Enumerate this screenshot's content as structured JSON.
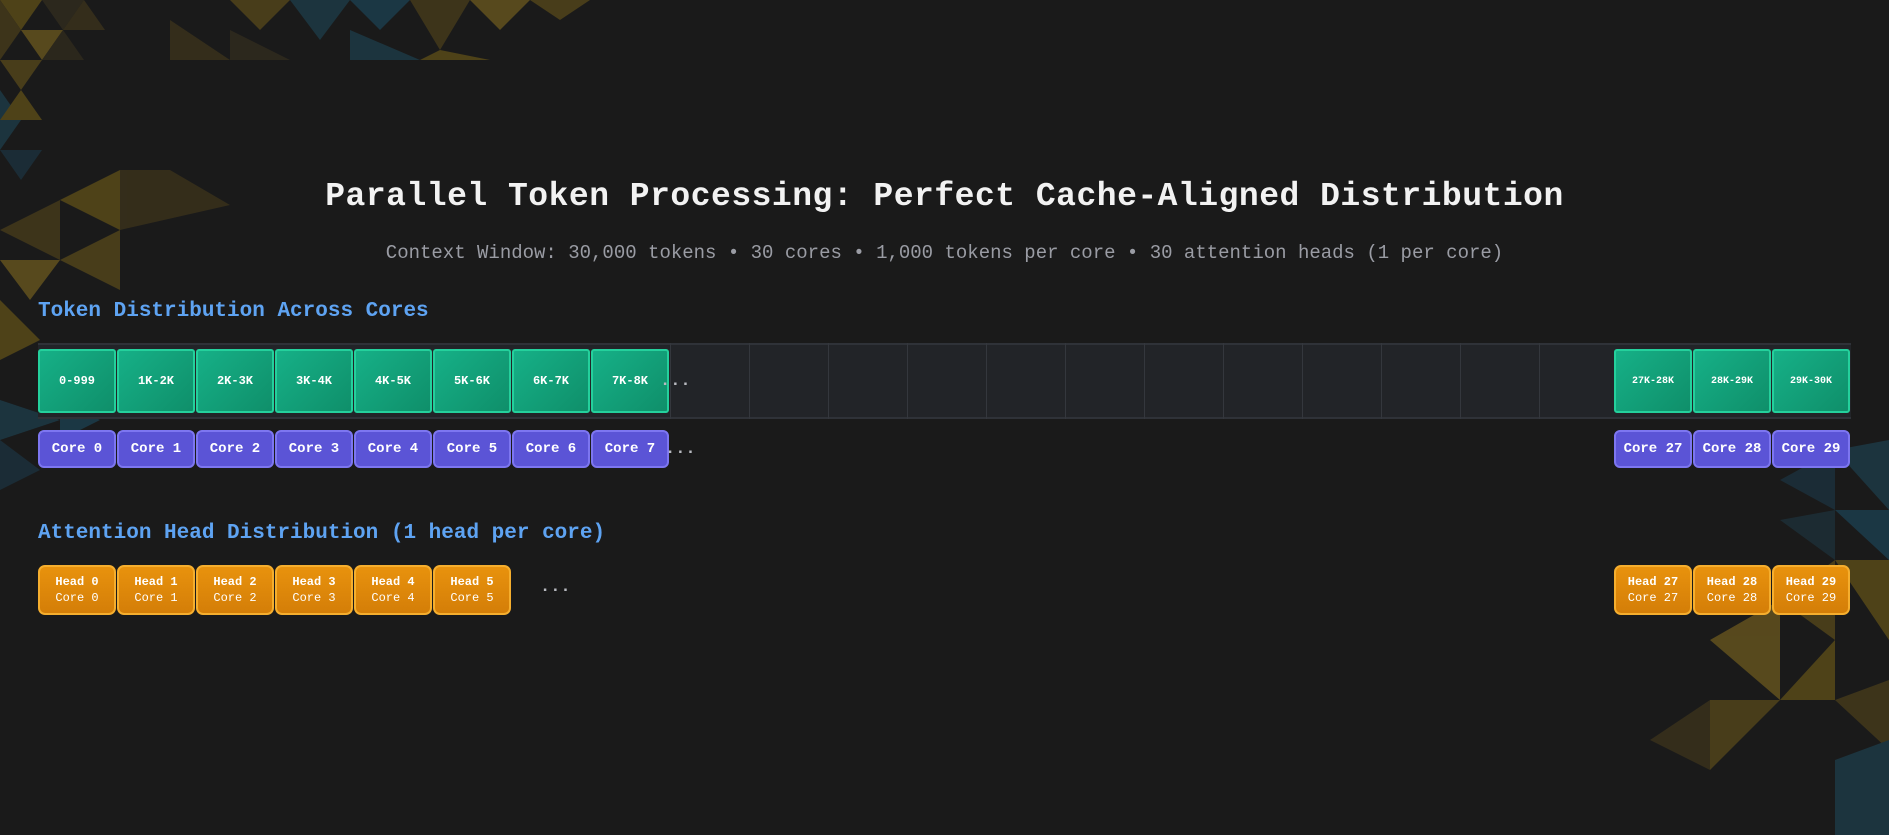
{
  "title": "Parallel Token Processing: Perfect Cache-Aligned Distribution",
  "subtitle": "Context Window: 30,000 tokens • 30 cores • 1,000 tokens per core • 30 attention heads (1 per core)",
  "sections": {
    "tokens": "Token Distribution Across Cores",
    "heads": "Attention Head Distribution (1 head per core)"
  },
  "tokens_left": [
    "0-999",
    "1K-2K",
    "2K-3K",
    "3K-4K",
    "4K-5K",
    "5K-6K",
    "6K-7K",
    "7K-8K"
  ],
  "tokens_right": [
    "27K-28K",
    "28K-29K",
    "29K-30K"
  ],
  "cores_left": [
    "Core 0",
    "Core 1",
    "Core 2",
    "Core 3",
    "Core 4",
    "Core 5",
    "Core 6",
    "Core 7"
  ],
  "cores_right": [
    "Core 27",
    "Core 28",
    "Core 29"
  ],
  "heads_left": [
    {
      "head": "Head 0",
      "core": "Core 0"
    },
    {
      "head": "Head 1",
      "core": "Core 1"
    },
    {
      "head": "Head 2",
      "core": "Core 2"
    },
    {
      "head": "Head 3",
      "core": "Core 3"
    },
    {
      "head": "Head 4",
      "core": "Core 4"
    },
    {
      "head": "Head 5",
      "core": "Core 5"
    }
  ],
  "heads_right": [
    {
      "head": "Head 27",
      "core": "Core 27"
    },
    {
      "head": "Head 28",
      "core": "Core 28"
    },
    {
      "head": "Head 29",
      "core": "Core 29"
    }
  ],
  "ellipsis": {
    "tokens": "...",
    "cores": "...",
    "heads": "..."
  },
  "colors": {
    "background": "#1a1a1a",
    "token": "#16b087",
    "core": "#5b54d6",
    "head": "#e8920d",
    "section_title": "#5ea3f2"
  }
}
